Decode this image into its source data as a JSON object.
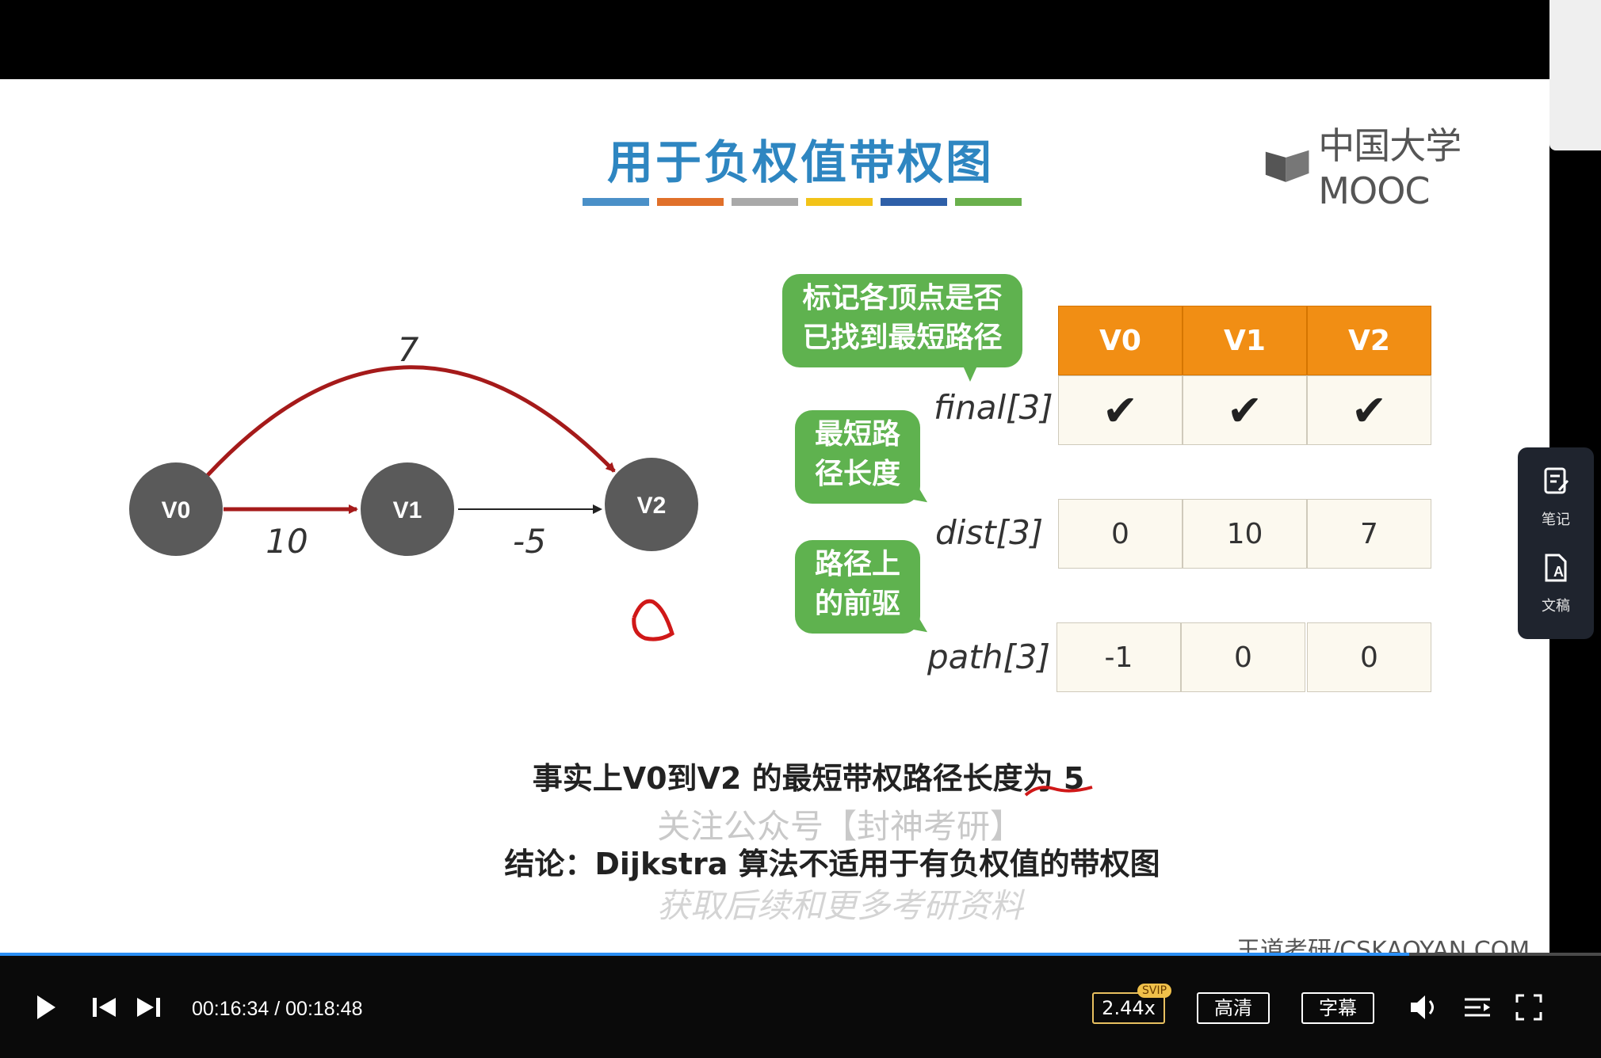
{
  "slide": {
    "title": "用于负权值带权图",
    "title_bar_colors": [
      "#4a90c8",
      "#e0702a",
      "#a9a9a9",
      "#f2c318",
      "#2e5fa8",
      "#6ab04c"
    ],
    "logo_text": "中国大学MOOC",
    "graph": {
      "nodes": [
        "V0",
        "V1",
        "V2"
      ],
      "edges": [
        {
          "from": "V0",
          "to": "V1",
          "weight": "10"
        },
        {
          "from": "V1",
          "to": "V2",
          "weight": "-5"
        },
        {
          "from": "V0",
          "to": "V2",
          "weight": "7"
        }
      ]
    },
    "bubbles": {
      "final": "标记各顶点是否已找到最短路径",
      "final_lines": [
        "标记各顶点是否",
        "已找到最短路径"
      ],
      "dist_lines": [
        "最短路",
        "径长度"
      ],
      "path_lines": [
        "路径上",
        "的前驱"
      ]
    },
    "table": {
      "headers": [
        "V0",
        "V1",
        "V2"
      ],
      "rows": [
        {
          "label": "final[3]",
          "values": [
            "✔",
            "✔",
            "✔"
          ]
        },
        {
          "label": "dist[3]",
          "values": [
            "0",
            "10",
            "7"
          ]
        },
        {
          "label": "path[3]",
          "values": [
            "-1",
            "0",
            "0"
          ]
        }
      ]
    },
    "fact_text": "事实上V0到V2 的最短带权路径长度为 5",
    "conclusion_text": "结论：Dijkstra 算法不适用于有负权值的带权图",
    "watermark_line1": "关注公众号【封神考研】",
    "watermark_line2": "获取后续和更多考研资料",
    "credit": "王道考研/CSKAOYAN.COM"
  },
  "player": {
    "progress": 0.88,
    "current_time": "00:16:34",
    "duration": "00:18:48",
    "time_display": "00:16:34 / 00:18:48",
    "speed": "2.44x",
    "speed_badge": "SVIP",
    "quality": "高清",
    "subtitles": "字幕",
    "icons": [
      "play-icon",
      "previous-icon",
      "next-icon",
      "volume-icon",
      "playlist-icon",
      "fullscreen-icon"
    ]
  },
  "side_tools": {
    "notes_label": "笔记",
    "transcript_label": "文稿"
  }
}
